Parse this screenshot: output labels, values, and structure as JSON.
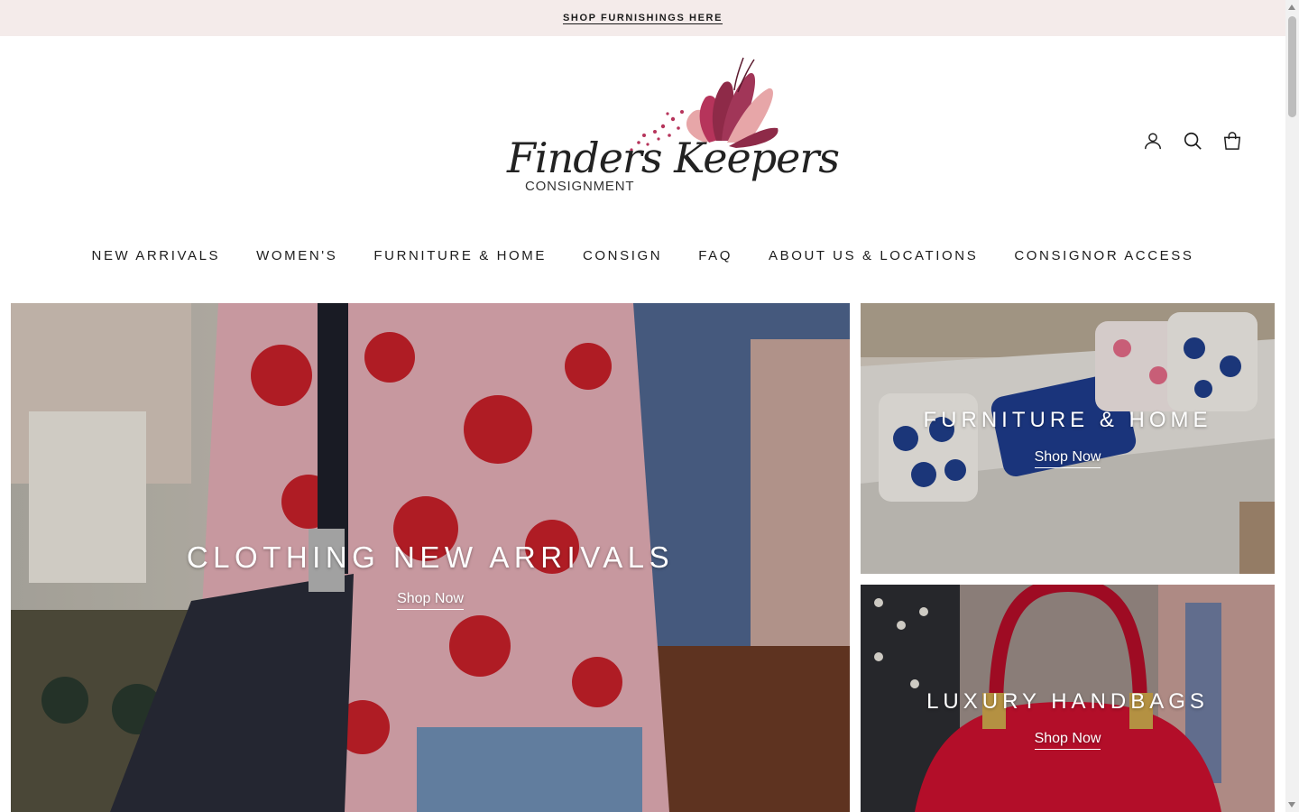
{
  "announcement": {
    "link_text": "SHOP FURNISHINGS HERE"
  },
  "logo": {
    "script_text": "Finders Keepers",
    "sub_text": "CONSIGNMENT"
  },
  "header_icons": [
    "account-icon",
    "search-icon",
    "cart-icon"
  ],
  "nav": {
    "items": [
      {
        "label": "NEW ARRIVALS"
      },
      {
        "label": "WOMEN'S"
      },
      {
        "label": "FURNITURE & HOME"
      },
      {
        "label": "CONSIGN"
      },
      {
        "label": "FAQ"
      },
      {
        "label": "ABOUT US & LOCATIONS"
      },
      {
        "label": "CONSIGNOR ACCESS"
      }
    ]
  },
  "hero": {
    "main": {
      "title": "CLOTHING NEW ARRIVALS",
      "link": "Shop Now"
    },
    "top_right": {
      "title": "FURNITURE & HOME",
      "link": "Shop Now"
    },
    "bottom_right": {
      "title": "LUXURY HANDBAGS",
      "link": "Shop Now"
    }
  },
  "colors": {
    "announcement_bg": "#f4ebea",
    "text": "#1c1c1c",
    "logo_accent_dark": "#8e2a48",
    "logo_accent_light": "#e7a6a8",
    "overlay_text": "#ffffff"
  }
}
